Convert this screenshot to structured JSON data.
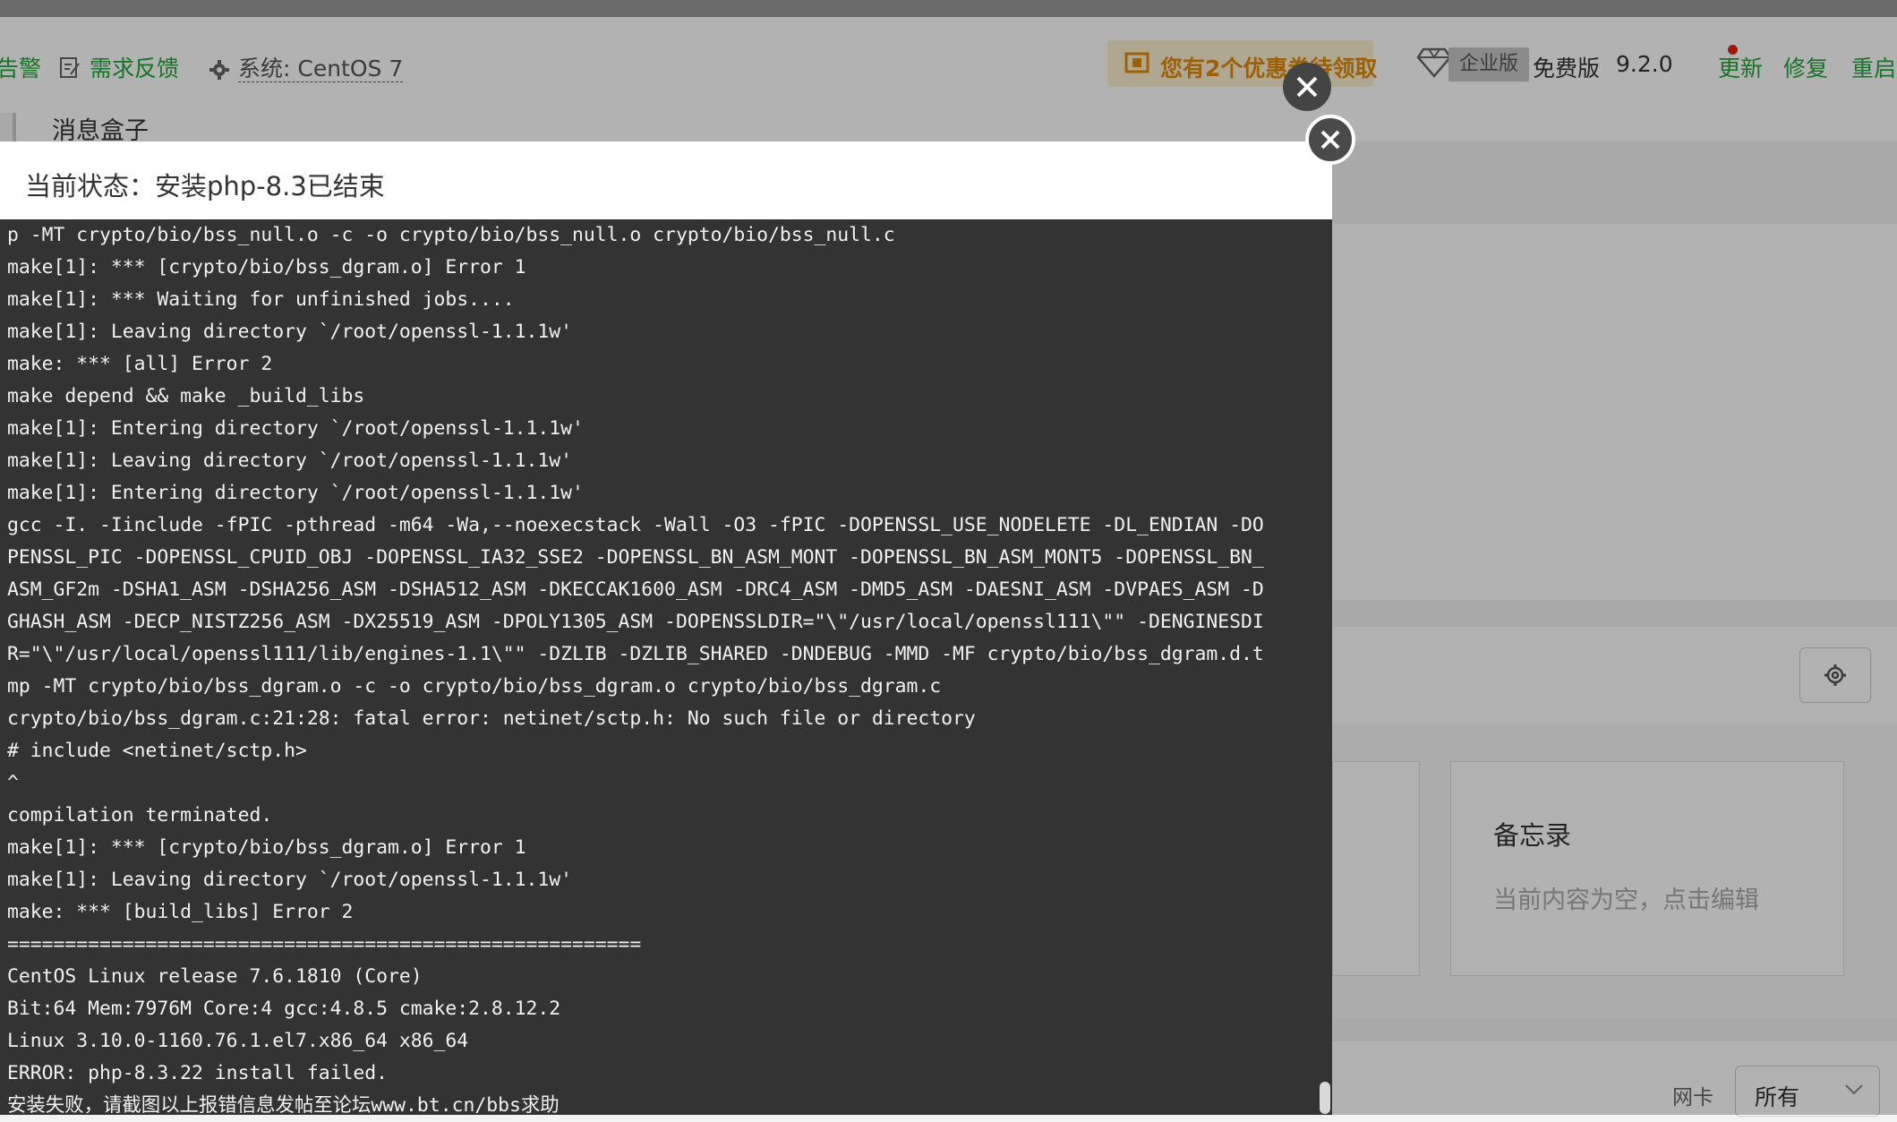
{
  "topbar": {
    "alert_fragment": "告警",
    "feedback": "需求反馈",
    "system": "系统: CentOS 7",
    "promo": "您有2个优惠券待领取",
    "edition_badge": "企业版",
    "free_edition": "免费版",
    "version": "9.2.0",
    "update": "更新",
    "repair": "修复",
    "restart": "重启"
  },
  "tabs": {
    "message_box": "消息盒子"
  },
  "background": {
    "memo_title": "备忘录",
    "memo_placeholder": "当前内容为空，点击编辑",
    "nic_label": "网卡",
    "nic_select": "所有"
  },
  "modal": {
    "status": "当前状态：安装php-8.3已结束",
    "log_lines": [
      "p -MT crypto/bio/bss_null.o -c -o crypto/bio/bss_null.o crypto/bio/bss_null.c",
      "make[1]: *** [crypto/bio/bss_dgram.o] Error 1",
      "make[1]: *** Waiting for unfinished jobs....",
      "make[1]: Leaving directory `/root/openssl-1.1.1w'",
      "make: *** [all] Error 2",
      "make depend && make _build_libs",
      "make[1]: Entering directory `/root/openssl-1.1.1w'",
      "make[1]: Leaving directory `/root/openssl-1.1.1w'",
      "make[1]: Entering directory `/root/openssl-1.1.1w'",
      "gcc -I. -Iinclude -fPIC -pthread -m64 -Wa,--noexecstack -Wall -O3 -fPIC -DOPENSSL_USE_NODELETE -DL_ENDIAN -DO",
      "PENSSL_PIC -DOPENSSL_CPUID_OBJ -DOPENSSL_IA32_SSE2 -DOPENSSL_BN_ASM_MONT -DOPENSSL_BN_ASM_MONT5 -DOPENSSL_BN_",
      "ASM_GF2m -DSHA1_ASM -DSHA256_ASM -DSHA512_ASM -DKECCAK1600_ASM -DRC4_ASM -DMD5_ASM -DAESNI_ASM -DVPAES_ASM -D",
      "GHASH_ASM -DECP_NISTZ256_ASM -DX25519_ASM -DPOLY1305_ASM -DOPENSSLDIR=\"\\\"/usr/local/openssl111\\\"\" -DENGINESDI",
      "R=\"\\\"/usr/local/openssl111/lib/engines-1.1\\\"\" -DZLIB -DZLIB_SHARED -DNDEBUG -MMD -MF crypto/bio/bss_dgram.d.t",
      "mp -MT crypto/bio/bss_dgram.o -c -o crypto/bio/bss_dgram.o crypto/bio/bss_dgram.c",
      "crypto/bio/bss_dgram.c:21:28: fatal error: netinet/sctp.h: No such file or directory",
      "# include <netinet/sctp.h>",
      "^",
      "compilation terminated.",
      "make[1]: *** [crypto/bio/bss_dgram.o] Error 1",
      "make[1]: Leaving directory `/root/openssl-1.1.1w'",
      "make: *** [build_libs] Error 2",
      "=======================================================",
      "CentOS Linux release 7.6.1810 (Core)",
      "Bit:64 Mem:7976M Core:4 gcc:4.8.5 cmake:2.8.12.2",
      "Linux 3.10.0-1160.76.1.el7.x86_64 x86_64",
      "ERROR: php-8.3.22 install failed.",
      "安装失败，请截图以上报错信息发帖至论坛www.bt.cn/bbs求助"
    ]
  },
  "colors": {
    "accent_green": "#20a53a",
    "promo_orange": "#e08a0c",
    "console_bg": "#333333",
    "update_dot": "#e0251b"
  }
}
